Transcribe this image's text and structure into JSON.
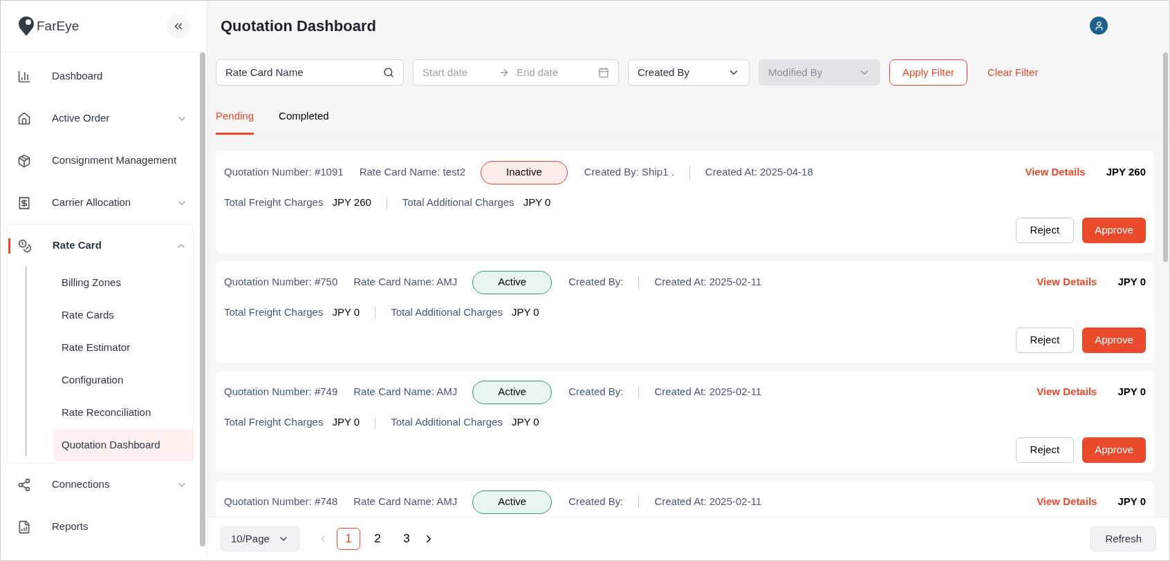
{
  "sidebar": {
    "logo": "FarEye",
    "items": [
      {
        "label": "Dashboard",
        "selected": false
      },
      {
        "label": "Active Order",
        "selected": false,
        "expanded": false
      },
      {
        "label": "Consignment Management",
        "selected": false
      },
      {
        "label": "Carrier Allocation",
        "selected": false,
        "expanded": false
      },
      {
        "label": "Rate Card",
        "selected": true,
        "expanded": true,
        "children": [
          {
            "label": "Billing Zones",
            "selected": false
          },
          {
            "label": "Rate Cards",
            "selected": false
          },
          {
            "label": "Rate Estimator",
            "selected": false
          },
          {
            "label": "Configuration",
            "selected": false
          },
          {
            "label": "Rate Reconciliation",
            "selected": false
          },
          {
            "label": "Quotation Dashboard",
            "selected": true
          }
        ]
      },
      {
        "label": "Connections",
        "selected": false,
        "expanded": false
      },
      {
        "label": "Reports",
        "selected": false
      }
    ]
  },
  "header": {
    "title": "Quotation Dashboard"
  },
  "filters": {
    "rate_card_name": {
      "placeholder": "Rate Card Name"
    },
    "start_date": {
      "placeholder": "Start date"
    },
    "end_date": {
      "placeholder": "End date"
    },
    "created_by": {
      "value": "Created By",
      "disabled": false
    },
    "modified_by": {
      "value": "Modified By",
      "disabled": true
    },
    "apply": "Apply Filter",
    "clear": "Clear Filter"
  },
  "tabs": [
    {
      "label": "Pending",
      "selected": true
    },
    {
      "label": "Completed",
      "selected": false
    }
  ],
  "quotations": [
    {
      "number": "Quotation Number: #1091",
      "rate_card": "Rate Card Name: test2",
      "status": {
        "label": "Inactive",
        "active": false
      },
      "created_by": "Created By: Ship1 .",
      "created_at": "Created At: 2025-04-18",
      "view": "View Details",
      "total": "JPY 260",
      "freight_label": "Total Freight Charges",
      "freight": "JPY 260",
      "additional_label": "Total Additional Charges",
      "additional": "JPY 0",
      "reject": "Reject",
      "approve": "Approve"
    },
    {
      "number": "Quotation Number: #750",
      "rate_card": "Rate Card Name: AMJ",
      "status": {
        "label": "Active",
        "active": true
      },
      "created_by": "Created By:",
      "created_at": "Created At: 2025-02-11",
      "view": "View Details",
      "total": "JPY 0",
      "freight_label": "Total Freight Charges",
      "freight": "JPY 0",
      "additional_label": "Total Additional Charges",
      "additional": "JPY 0",
      "reject": "Reject",
      "approve": "Approve"
    },
    {
      "number": "Quotation Number: #749",
      "rate_card": "Rate Card Name: AMJ",
      "status": {
        "label": "Active",
        "active": true
      },
      "created_by": "Created By:",
      "created_at": "Created At: 2025-02-11",
      "view": "View Details",
      "total": "JPY 0",
      "freight_label": "Total Freight Charges",
      "freight": "JPY 0",
      "additional_label": "Total Additional Charges",
      "additional": "JPY 0",
      "reject": "Reject",
      "approve": "Approve"
    },
    {
      "number": "Quotation Number: #748",
      "rate_card": "Rate Card Name: AMJ",
      "status": {
        "label": "Active",
        "active": true
      },
      "created_by": "Created By:",
      "created_at": "Created At: 2025-02-11",
      "view": "View Details",
      "total": "JPY 0"
    }
  ],
  "footer": {
    "page_size": "10/Page",
    "pages": [
      {
        "label": "1",
        "selected": true
      },
      {
        "label": "2",
        "selected": false
      },
      {
        "label": "3",
        "selected": false
      }
    ],
    "refresh": "Refresh"
  }
}
